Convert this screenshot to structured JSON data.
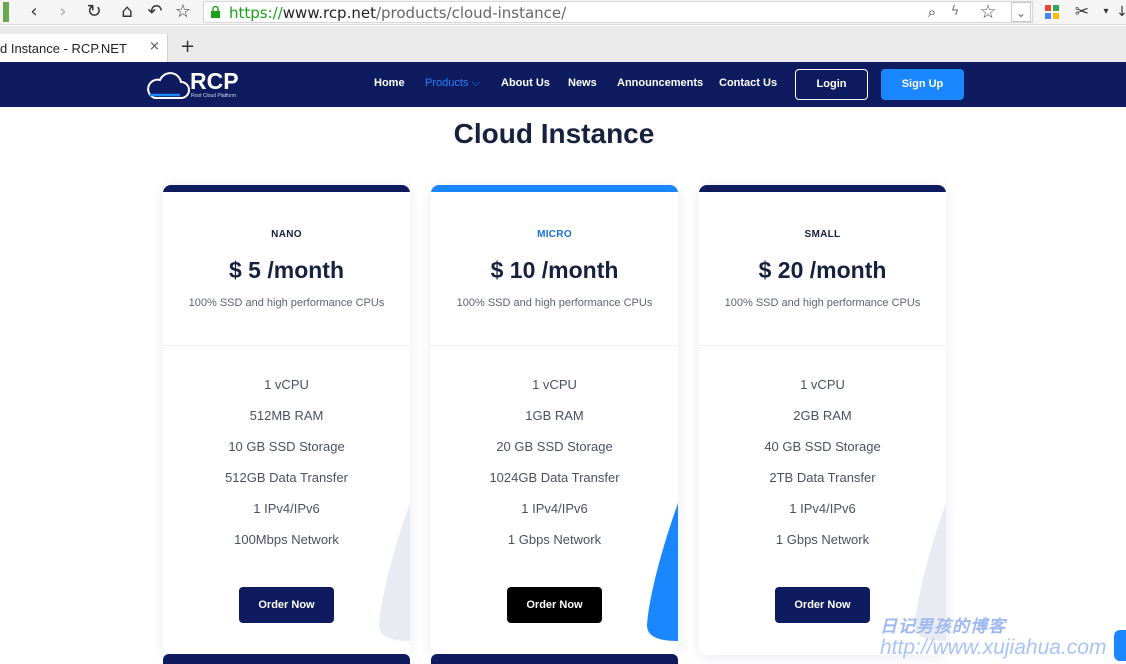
{
  "browser": {
    "url_protocol": "https://",
    "url_host": "www.rcp.net",
    "url_path": "/products/cloud-instance/",
    "tab_title": "d Instance - RCP.NET",
    "tab_close": "×",
    "new_tab": "+"
  },
  "header": {
    "logo_text": "RCP",
    "logo_sub": "Root Cloud Platform",
    "menu": [
      {
        "label": "Home"
      },
      {
        "label": "Products ⌵"
      },
      {
        "label": "About Us"
      },
      {
        "label": "News"
      },
      {
        "label": "Announcements"
      },
      {
        "label": "Contact Us"
      }
    ],
    "login": "Login",
    "signup": "Sign Up",
    "brand_color": "#0e1c5f",
    "accent_color": "#1a86ff"
  },
  "page": {
    "title": "Cloud Instance"
  },
  "plans": [
    {
      "tier": "NANO",
      "price": "$ 5 /month",
      "desc": "100% SSD and high performance CPUs",
      "features": [
        "1 vCPU",
        "512MB RAM",
        "10 GB SSD Storage",
        "512GB Data Transfer",
        "1 IPv4/IPv6",
        "100Mbps Network"
      ],
      "order": "Order Now"
    },
    {
      "tier": "MICRO",
      "price": "$ 10 /month",
      "desc": "100% SSD and high performance CPUs",
      "features": [
        "1 vCPU",
        "1GB RAM",
        "20 GB SSD Storage",
        "1024GB Data Transfer",
        "1 IPv4/IPv6",
        "1 Gbps Network"
      ],
      "order": "Order Now"
    },
    {
      "tier": "SMALL",
      "price": "$ 20 /month",
      "desc": "100% SSD and high performance CPUs",
      "features": [
        "1 vCPU",
        "2GB RAM",
        "40 GB SSD Storage",
        "2TB Data Transfer",
        "1 IPv4/IPv6",
        "1 Gbps Network"
      ],
      "order": "Order Now"
    }
  ],
  "watermark": {
    "line1": "日记男孩的博客",
    "line2": "http://www.xujiahua.com"
  }
}
